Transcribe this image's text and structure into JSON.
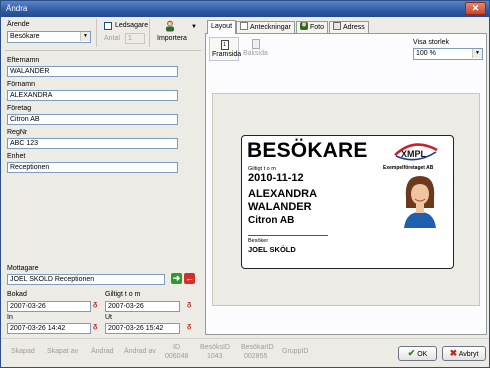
{
  "window": {
    "title": "Ändra"
  },
  "left": {
    "arende_label": "Ärende",
    "arende_value": "Besökare",
    "ledsagare_label": "Ledsagare",
    "antal_label": "Antal",
    "antal_value": "1",
    "importera_label": "Importera",
    "efternamn_label": "Efternamn",
    "efternamn_value": "WALANDER",
    "fornamn_label": "Förnamn",
    "fornamn_value": "ALEXANDRA",
    "foretag_label": "Företag",
    "foretag_value": "Citron AB",
    "regnr_label": "RegNr",
    "regnr_value": "ABC 123",
    "enhet_label": "Enhet",
    "enhet_value": "Receptionen",
    "mottagare_label": "Mottagare",
    "mottagare_value": "JOEL SKÖLD Receptionen",
    "bokad_label": "Bokad",
    "bokad_value": "2007-03-26",
    "giltigt_label": "Giltigt t o m",
    "giltigt_value": "2007-03-26",
    "in_label": "In",
    "in_value": "2007-03-26 14:42",
    "ut_label": "Ut",
    "ut_value": "2007-03-26 15:42"
  },
  "tabs": [
    {
      "label": "Layout"
    },
    {
      "label": "Anteckningar"
    },
    {
      "label": "Foto"
    },
    {
      "label": "Adress"
    }
  ],
  "layout": {
    "framsida_label": "Framsida",
    "baksida_label": "Baksida",
    "visa_storlek_label": "Visa storlek",
    "visa_storlek_value": "100 %"
  },
  "card": {
    "heading": "BESÖKARE",
    "giltigt_label": "Giltigt t o m",
    "giltigt_date": "2010-11-12",
    "first_name": "ALEXANDRA",
    "last_name": "WALANDER",
    "company": "Citron AB",
    "logo_text": "XMPL",
    "logo_company": "Exempelföretaget AB",
    "besoker_label": "Besöker",
    "besoker_name": "JOEL SKÖLD"
  },
  "bottom": {
    "skapad": "Skapad",
    "skapad_av": "Skapat av",
    "andrad": "Ändrad",
    "andrad_av": "Ändrad av",
    "id_label": "ID",
    "id_value": "006048",
    "besoksid_label": "BesöksID",
    "besoksid_value": "1043",
    "besokarid_label": "BesökarID",
    "besokarid_value": "002855",
    "gruppid_label": "GruppID",
    "ok_label": "OK",
    "avbryt_label": "Avbryt"
  },
  "colors": {
    "titlebar": "#2d5aa6",
    "card_logo": "#cc1f2d",
    "ok_check": "#1f8a1f",
    "cancel_x": "#c0271c"
  }
}
